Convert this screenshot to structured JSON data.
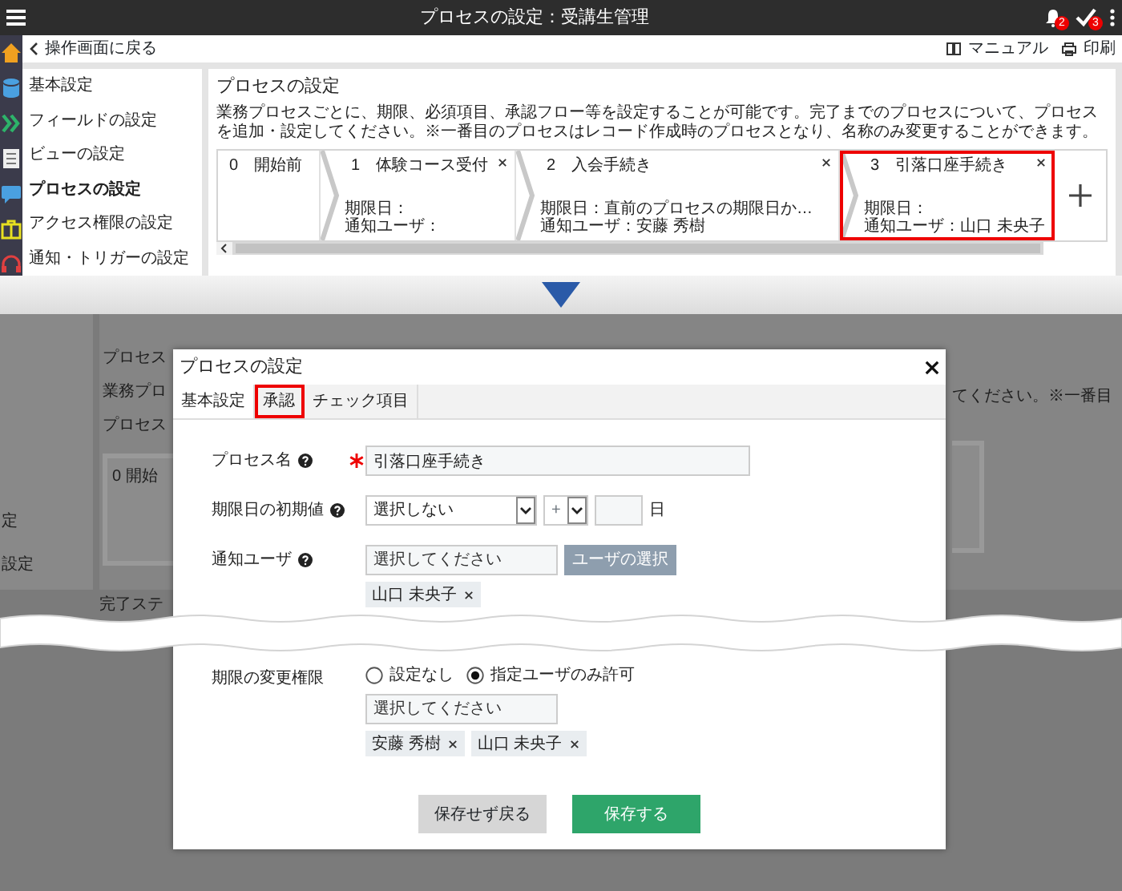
{
  "header": {
    "title": "プロセスの設定：受講生管理",
    "notification_count": "2",
    "task_count": "3"
  },
  "subbar": {
    "back": "操作画面に戻る",
    "manual": "マニュアル",
    "print": "印刷"
  },
  "settings_menu": [
    {
      "label": "基本設定",
      "selected": false
    },
    {
      "label": "フィールドの設定",
      "selected": false
    },
    {
      "label": "ビューの設定",
      "selected": false
    },
    {
      "label": "プロセスの設定",
      "selected": true
    },
    {
      "label": "アクセス権限の設定",
      "selected": false
    },
    {
      "label": "通知・トリガーの設定",
      "selected": false
    }
  ],
  "process_panel": {
    "title": "プロセスの設定",
    "description": "業務プロセスごとに、期限、必須項目、承認フロー等を設定することが可能です。完了までのプロセスについて、プロセスを追加・設定してください。※一番目のプロセスはレコード作成時のプロセスとなり、名称のみ変更することができます。",
    "steps": [
      {
        "number": "0",
        "name": "開始前",
        "removable": false,
        "highlighted": false
      },
      {
        "number": "1",
        "name": "体験コース受付",
        "due": "期限日：",
        "notify": "通知ユーザ：",
        "removable": true,
        "highlighted": false
      },
      {
        "number": "2",
        "name": "入会手続き",
        "due": "期限日：直前のプロセスの期限日か…",
        "notify": "通知ユーザ：安藤 秀樹",
        "removable": true,
        "highlighted": false
      },
      {
        "number": "3",
        "name": "引落口座手続き",
        "due": "期限日：",
        "notify": "通知ユーザ：山口 未央子",
        "removable": true,
        "highlighted": true
      }
    ]
  },
  "dimmed_background": {
    "menu_fragments": [
      "定",
      "設定"
    ],
    "panel_fragments": [
      "プロセス",
      "業務プロ",
      "プロセス"
    ],
    "step_fragment": "0 開始",
    "right_fragment": "てください。※一番目",
    "bottom_fragment": "完了ステ"
  },
  "dialog": {
    "title": "プロセスの設定",
    "tabs": [
      {
        "label": "基本設定",
        "selected": true,
        "highlighted": false
      },
      {
        "label": "承認",
        "selected": false,
        "highlighted": true
      },
      {
        "label": "チェック項目",
        "selected": false,
        "highlighted": false
      }
    ],
    "fields_above_tear": [
      {
        "kind": "text",
        "label": "プロセス名",
        "help": true,
        "required": true,
        "value": "引落口座手続き"
      },
      {
        "kind": "deadline",
        "label": "期限日の初期値",
        "help": true,
        "required": false,
        "select": "選択しない",
        "sign": "+",
        "unit": "日"
      },
      {
        "kind": "users",
        "label": "通知ユーザ",
        "help": true,
        "required": false,
        "placeholder": "選択してください",
        "button": "ユーザの選択",
        "chips": [
          "山口 未央子"
        ]
      }
    ],
    "fields_below_tear": [
      {
        "kind": "radio_users",
        "label": "期限の変更権限",
        "help": false,
        "required": false,
        "options": [
          {
            "label": "設定なし",
            "selected": false
          },
          {
            "label": "指定ユーザのみ許可",
            "selected": true
          }
        ],
        "placeholder": "選択してください",
        "chips": [
          "安藤 秀樹",
          "山口 未央子"
        ]
      }
    ],
    "buttons": [
      {
        "label": "保存せず戻る",
        "kind": "secondary"
      },
      {
        "label": "保存する",
        "kind": "primary"
      }
    ]
  }
}
